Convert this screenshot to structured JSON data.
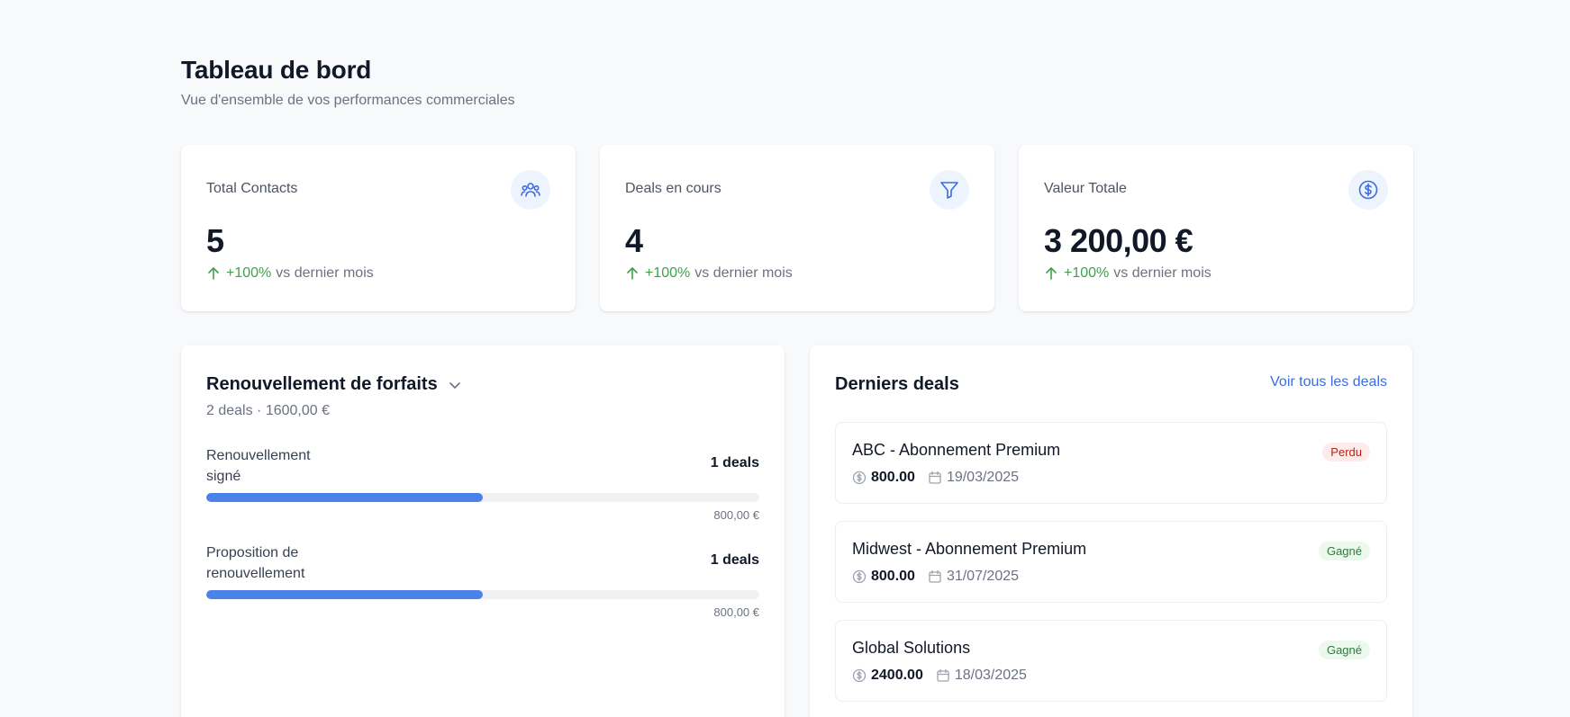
{
  "header": {
    "title": "Tableau de bord",
    "subtitle": "Vue d'ensemble de vos performances commerciales"
  },
  "stats": [
    {
      "label": "Total Contacts",
      "value": "5",
      "icon": "users-icon",
      "trend": "+100%",
      "trend_text": "vs dernier mois"
    },
    {
      "label": "Deals en cours",
      "value": "4",
      "icon": "filter-icon",
      "trend": "+100%",
      "trend_text": "vs dernier mois"
    },
    {
      "label": "Valeur Totale",
      "value": "3 200,00 €",
      "icon": "dollar-circle-icon",
      "trend": "+100%",
      "trend_text": "vs dernier mois"
    }
  ],
  "pipeline": {
    "title": "Renouvellement de forfaits",
    "summary": "2 deals · 1600,00 €",
    "stages": [
      {
        "name": "Renouvellement signé",
        "count": "1 deals",
        "amount": "800,00 €",
        "progress": 0.5
      },
      {
        "name": "Proposition de renouvellement",
        "count": "1 deals",
        "amount": "800,00 €",
        "progress": 0.5
      }
    ]
  },
  "deals": {
    "title": "Derniers deals",
    "link": "Voir tous les deals",
    "items": [
      {
        "name": "ABC - Abonnement Premium",
        "amount": "800.00",
        "date": "19/03/2025",
        "status": "Perdu",
        "status_type": "lost"
      },
      {
        "name": "Midwest - Abonnement Premium",
        "amount": "800.00",
        "date": "31/07/2025",
        "status": "Gagné",
        "status_type": "won"
      },
      {
        "name": "Global Solutions",
        "amount": "2400.00",
        "date": "18/03/2025",
        "status": "Gagné",
        "status_type": "won"
      }
    ]
  },
  "colors": {
    "accent": "#3b6ce3",
    "progress": "#4b82ea",
    "positive": "#3fa14f",
    "lost_bg": "#fdecec",
    "lost_text": "#b42318",
    "won_bg": "#ecf7ee",
    "won_text": "#2f7a3b"
  }
}
